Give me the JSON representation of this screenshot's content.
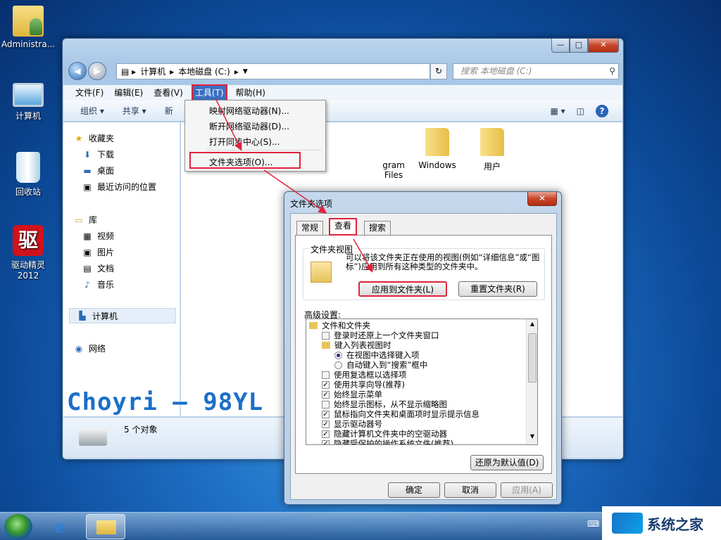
{
  "desktop": {
    "icons": [
      {
        "label": "Administra..."
      },
      {
        "label": "计算机"
      },
      {
        "label": "回收站"
      },
      {
        "label": "驱动精灵\n2012",
        "glyph": "驱"
      }
    ]
  },
  "explorer": {
    "window_buttons": {
      "minimize": "—",
      "maximize": "□",
      "close": "✕"
    },
    "address_parts": [
      "计算机",
      "本地磁盘 (C:)"
    ],
    "search_placeholder": "搜索 本地磁盘 (C:)",
    "menu": [
      "文件(F)",
      "编辑(E)",
      "查看(V)",
      "工具(T)",
      "帮助(H)"
    ],
    "toolbar": {
      "organize": "组织 ▾",
      "share": "共享 ▾",
      "new": "新"
    },
    "sidebar": {
      "favorites": "收藏夹",
      "downloads": "下载",
      "desktop": "桌面",
      "recent": "最近访问的位置",
      "libraries": "库",
      "videos": "视频",
      "pictures": "图片",
      "documents": "文档",
      "music": "音乐",
      "computer": "计算机",
      "network": "网络"
    },
    "folders": [
      {
        "label": "gram\nFiles"
      },
      {
        "label": "Windows"
      },
      {
        "label": "用户"
      }
    ],
    "status": "5 个对象",
    "watermark": "Choyri — 98YL"
  },
  "tools_menu": {
    "items": [
      "映射网络驱动器(N)...",
      "断开网络驱动器(D)...",
      "打开同步中心(S)...",
      "文件夹选项(O)..."
    ]
  },
  "folder_options": {
    "title": "文件夹选项",
    "close": "✕",
    "tabs": [
      "常规",
      "查看",
      "搜索"
    ],
    "active_tab": "查看",
    "folder_view_group": "文件夹视图",
    "folder_view_text": "可以将该文件夹正在使用的视图(例如“详细信息”或“图标”)应用到所有这种类型的文件夹中。",
    "apply_to_folders": "应用到文件夹(L)",
    "reset_folders": "重置文件夹(R)",
    "advanced_label": "高级设置:",
    "advanced": [
      {
        "type": "folder",
        "text": "文件和文件夹"
      },
      {
        "type": "check",
        "checked": false,
        "text": "登录时还原上一个文件夹窗口"
      },
      {
        "type": "folder",
        "text": "键入列表视图时"
      },
      {
        "type": "radio",
        "checked": true,
        "text": "在视图中选择键入项"
      },
      {
        "type": "radio",
        "checked": false,
        "text": "自动键入到“搜索”框中"
      },
      {
        "type": "check",
        "checked": false,
        "text": "使用复选框以选择项"
      },
      {
        "type": "check",
        "checked": true,
        "text": "使用共享向导(推荐)"
      },
      {
        "type": "check",
        "checked": true,
        "text": "始终显示菜单"
      },
      {
        "type": "check",
        "checked": false,
        "text": "始终显示图标，从不显示缩略图"
      },
      {
        "type": "check",
        "checked": true,
        "text": "鼠标指向文件夹和桌面项时显示提示信息"
      },
      {
        "type": "check",
        "checked": true,
        "text": "显示驱动器号"
      },
      {
        "type": "check",
        "checked": true,
        "text": "隐藏计算机文件夹中的空驱动器"
      },
      {
        "type": "check",
        "checked": true,
        "text": "隐藏受保护的操作系统文件(推荐)"
      }
    ],
    "restore_defaults": "还原为默认值(D)",
    "ok": "确定",
    "cancel": "取消",
    "apply": "应用(A)"
  },
  "taskbar": {
    "brand": "系统之家"
  },
  "colors": {
    "highlight_red": "#e0233b",
    "accent_blue": "#1b6fc8"
  }
}
